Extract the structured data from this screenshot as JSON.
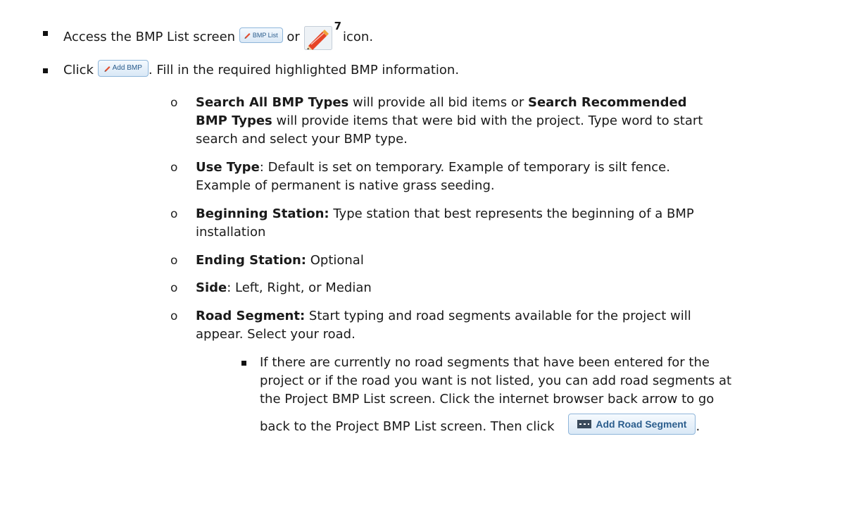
{
  "items": {
    "access": {
      "text_before": "Access the BMP List screen",
      "button_label": "BMP List",
      "text_or": "or",
      "superscript": "7",
      "text_after": "icon."
    },
    "click_add": {
      "text_before": "Click",
      "button_label": "Add BMP",
      "text_after": ". Fill in the required highlighted BMP information."
    },
    "search": {
      "b1": "Search All BMP Types",
      "t1": " will provide all bid items or ",
      "b2": "Search Recommended",
      "b3": "BMP Types",
      "t2": " will provide items that were bid with the project.  Type word to start",
      "t3": "search and select your BMP type."
    },
    "use_type": {
      "bold": "Use Type",
      "t1": ":  Default is set on temporary.  Example of temporary is silt fence.",
      "t2": "Example of permanent is native grass seeding."
    },
    "beginning": {
      "bold": "Beginning Station:",
      "t1": "  Type station that best represents the beginning of a BMP",
      "t2": "installation"
    },
    "ending": {
      "bold": "Ending Station:",
      "t1": "  Optional"
    },
    "side": {
      "bold": "Side",
      "t1": ":  Left, Right, or Median"
    },
    "road": {
      "bold": "Road Segment:",
      "t1": "  Start typing and road segments available for the project will",
      "t2": "appear.  Select your road."
    },
    "sub": {
      "l1": "If there are currently no road segments that have been entered for the",
      "l2": "project or if the road you want is not listed, you can add road segments at",
      "l3": "the Project BMP List screen. Click the internet browser back arrow to go",
      "l4": "back to the Project BMP List screen.  Then click",
      "button_label": "Add Road Segment",
      "end": "."
    }
  },
  "bullets": {
    "square": "■",
    "circle": "o"
  },
  "icons": {
    "bmp": "bmp-pencil-icon",
    "road": "road-segment-icon"
  },
  "colors": {
    "button_border": "#8fb6da",
    "button_text": "#2b5d8d"
  }
}
